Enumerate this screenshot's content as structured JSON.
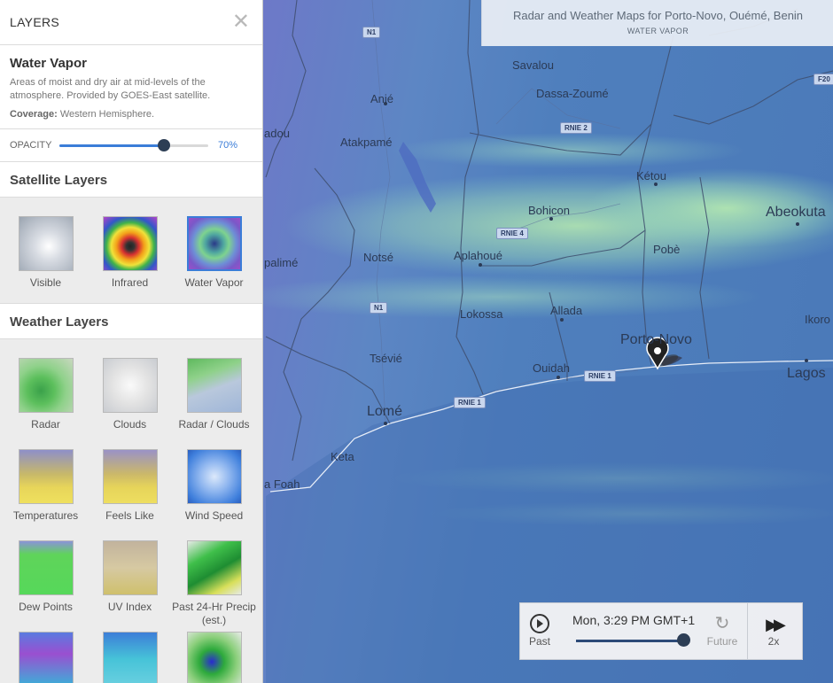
{
  "panel": {
    "title": "LAYERS",
    "close_icon": "close-icon",
    "layer_name": "Water Vapor",
    "layer_description": "Areas of moist and dry air at mid-levels of the atmosphere. Provided by GOES-East satellite.",
    "coverage_label": "Coverage:",
    "coverage_value": "Western Hemisphere.",
    "opacity_label": "OPACITY",
    "opacity_value": "70%",
    "opacity_fraction": 0.7,
    "satellite_section": "Satellite Layers",
    "satellite_layers": [
      {
        "label": "Visible",
        "selected": false
      },
      {
        "label": "Infrared",
        "selected": false
      },
      {
        "label": "Water Vapor",
        "selected": true
      }
    ],
    "weather_section": "Weather Layers",
    "weather_layers": [
      {
        "label": "Radar"
      },
      {
        "label": "Clouds"
      },
      {
        "label": "Radar / Clouds"
      },
      {
        "label": "Temperatures"
      },
      {
        "label": "Feels Like"
      },
      {
        "label": "Wind Speed"
      },
      {
        "label": "Dew Points"
      },
      {
        "label": "UV Index"
      },
      {
        "label": "Past 24-Hr Precip (est.)"
      }
    ]
  },
  "map_title": {
    "title": "Radar and Weather Maps for Porto-Novo, Ouémé, Benin",
    "subtitle": "WATER VAPOR"
  },
  "map": {
    "places": [
      "Savalou",
      "Dassa-Zoumé",
      "Anié",
      "Atakpamé",
      "adou",
      "Kétou",
      "Bohicon",
      "Abeokuta",
      "palimé",
      "Notsé",
      "Aplahoué",
      "Pobè",
      "Lokossa",
      "Allada",
      "Porto-Novo",
      "Ikoro",
      "Tsévié",
      "Ouidah",
      "Lagos",
      "Lomé",
      "Kpalimé",
      "Keta",
      "a Foah"
    ],
    "roads": [
      "N1",
      "RNIE 2",
      "RNIE 4",
      "N1",
      "RNIE 1",
      "RNIE 1",
      "F20"
    ],
    "marker_icon": "map-pin-icon"
  },
  "timeline": {
    "past_label": "Past",
    "current_time": "Mon, 3:29 PM GMT+1",
    "future_label": "Future",
    "speed_label": "2x",
    "position_fraction": 1.0
  },
  "colors": {
    "accent": "#3b7dd8",
    "knob": "#2d3e55"
  }
}
